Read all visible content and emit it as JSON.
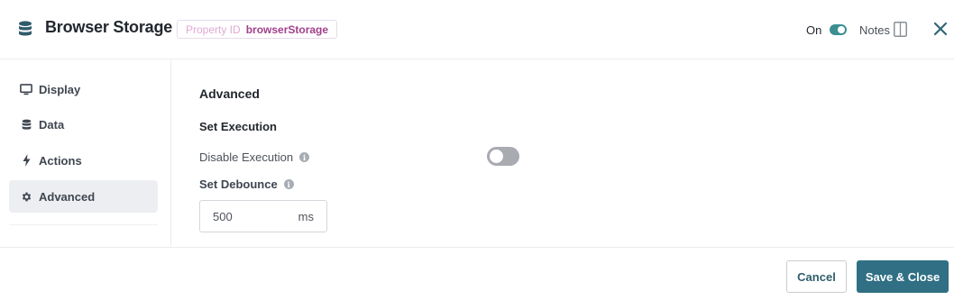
{
  "header": {
    "title": "Browser Storage",
    "title_icon": "database-icon",
    "property_id_key": "Property ID",
    "property_id_value": "browserStorage",
    "on_label": "On",
    "notes_label": "Notes",
    "close_icon": "close-icon"
  },
  "sidebar": {
    "items": [
      {
        "label": "Display",
        "icon": "monitor-icon",
        "active": false
      },
      {
        "label": "Data",
        "icon": "database-icon",
        "active": false
      },
      {
        "label": "Actions",
        "icon": "bolt-icon",
        "active": false
      },
      {
        "label": "Advanced",
        "icon": "gear-icon",
        "active": true
      }
    ]
  },
  "main": {
    "section_title": "Advanced",
    "subsection_title": "Set Execution",
    "disable_execution_label": "Disable Execution",
    "disable_execution_enabled": false,
    "debounce_label": "Set Debounce",
    "debounce_value": "500",
    "debounce_unit": "ms"
  },
  "footer": {
    "cancel_label": "Cancel",
    "save_label": "Save & Close"
  },
  "colors": {
    "accent": "#306f84",
    "toggle_on": "#3b8f91",
    "badge_value": "#a23f8a",
    "badge_key": "#e2a9d2"
  }
}
